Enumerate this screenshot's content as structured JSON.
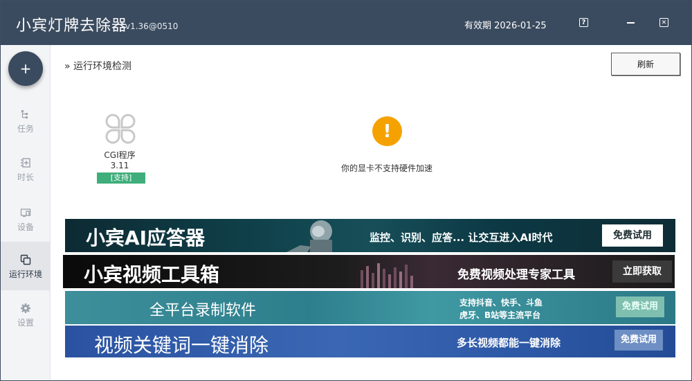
{
  "titlebar": {
    "app_name": "小宾灯牌去除器",
    "version": "v1.36@0510",
    "expiry": "有效期 2026-01-25",
    "help_label": "?",
    "close_label": "✕"
  },
  "sidebar": {
    "add_label": "+",
    "items": [
      {
        "label": "任务"
      },
      {
        "label": "时长"
      },
      {
        "label": "设备"
      },
      {
        "label": "运行环境"
      },
      {
        "label": "设置"
      }
    ]
  },
  "main": {
    "section_title": "» 运行环境检测",
    "refresh_label": "刷新",
    "cgi": {
      "name": "CGI程序",
      "version": "3.11",
      "status": "[支持]"
    },
    "warning": {
      "icon": "!",
      "text": "你的显卡不支持硬件加速"
    }
  },
  "banners": [
    {
      "title": "小宾AI应答器",
      "subtitle": "监控、识别、应答... 让交互进入AI时代",
      "cta": "免费试用"
    },
    {
      "title": "小宾视频工具箱",
      "subtitle": "免费视频处理专家工具",
      "cta": "立即获取"
    },
    {
      "title": "全平台录制软件",
      "subtitle_line1": "支持抖音、快手、斗鱼",
      "subtitle_line2": "虎牙、B站等主流平台",
      "cta": "免费试用"
    },
    {
      "title": "视频关键词一键消除",
      "subtitle": "多长视频都能一键消除",
      "cta": "免费试用"
    }
  ],
  "colors": {
    "titlebar": "#3b4b5f",
    "sidebar": "#f3f4f6",
    "support_badge": "#3fae7a",
    "warning": "#f5a200"
  }
}
